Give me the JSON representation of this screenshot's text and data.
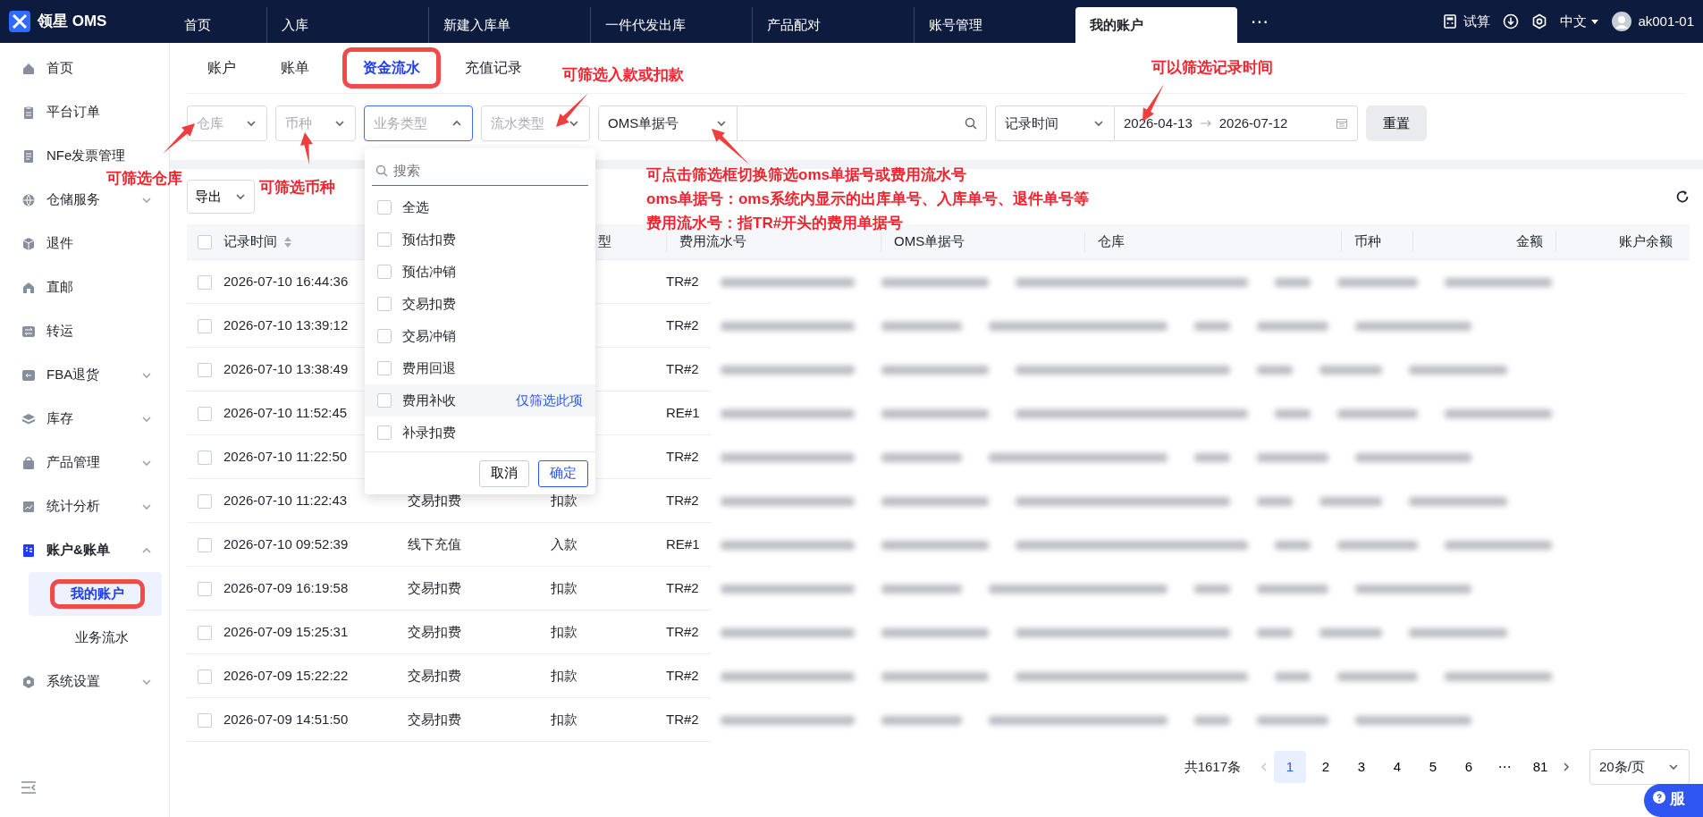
{
  "app": {
    "logo": "领星 OMS"
  },
  "top_tabs": [
    {
      "label": "首页",
      "selected": false
    },
    {
      "label": "入库",
      "selected": false
    },
    {
      "label": "新建入库单",
      "selected": false
    },
    {
      "label": "一件代发出库",
      "selected": false
    },
    {
      "label": "产品配对",
      "selected": false
    },
    {
      "label": "账号管理",
      "selected": false
    },
    {
      "label": "我的账户",
      "selected": true
    }
  ],
  "top_actions": {
    "more": "⋯",
    "trial": "试算",
    "language": "中文",
    "user": "ak001-01"
  },
  "sidebar": {
    "items": [
      {
        "label": "首页",
        "selected": false
      },
      {
        "label": "平台订单",
        "selected": false
      },
      {
        "label": "NFe发票管理",
        "selected": false
      },
      {
        "label": "仓储服务",
        "selected": false,
        "expanded": false
      },
      {
        "label": "退件",
        "selected": false
      },
      {
        "label": "直邮",
        "selected": false
      },
      {
        "label": "转运",
        "selected": false
      },
      {
        "label": "FBA退货",
        "selected": false,
        "expanded": false
      },
      {
        "label": "库存",
        "selected": false,
        "expanded": false
      },
      {
        "label": "产品管理",
        "selected": false,
        "expanded": false
      },
      {
        "label": "统计分析",
        "selected": false,
        "expanded": false
      },
      {
        "label": "账户&账单",
        "selected": true,
        "expanded": true,
        "children": [
          {
            "label": "我的账户",
            "selected": true,
            "highlighted": true
          },
          {
            "label": "业务流水",
            "selected": false,
            "highlighted": false
          }
        ]
      },
      {
        "label": "系统设置",
        "selected": false,
        "expanded": false
      }
    ]
  },
  "sub_tabs": [
    {
      "label": "账户",
      "selected": false,
      "highlighted": false
    },
    {
      "label": "账单",
      "selected": false,
      "highlighted": false
    },
    {
      "label": "资金流水",
      "selected": true,
      "highlighted": true
    },
    {
      "label": "充值记录",
      "selected": false,
      "highlighted": false
    }
  ],
  "filters": {
    "warehouse": {
      "placeholder": "仓库"
    },
    "currency": {
      "placeholder": "币种"
    },
    "business_type": {
      "placeholder": "业务类型",
      "expanded": true
    },
    "flow_type": {
      "placeholder": "流水类型"
    },
    "number_type": {
      "value": "OMS单据号"
    },
    "time_type": {
      "value": "记录时间"
    },
    "date_range": {
      "start": "2026-04-13",
      "end": "2026-07-12"
    },
    "reset": "重置"
  },
  "dropdown": {
    "search_placeholder": "搜索",
    "hover_action": "仅筛选此项",
    "cancel": "取消",
    "confirm": "确定",
    "options": [
      {
        "label": "全选",
        "checked": false,
        "hovered": false
      },
      {
        "label": "预估扣费",
        "checked": false,
        "hovered": false
      },
      {
        "label": "预估冲销",
        "checked": false,
        "hovered": false
      },
      {
        "label": "交易扣费",
        "checked": false,
        "hovered": false
      },
      {
        "label": "交易冲销",
        "checked": false,
        "hovered": false
      },
      {
        "label": "费用回退",
        "checked": false,
        "hovered": false
      },
      {
        "label": "费用补收",
        "checked": false,
        "hovered": true
      },
      {
        "label": "补录扣费",
        "checked": false,
        "hovered": false
      }
    ]
  },
  "toolbar": {
    "export": "导出"
  },
  "table": {
    "all_checked": false,
    "columns": [
      "记录时间",
      "型",
      "费用流水号",
      "OMS单据号",
      "仓库",
      "币种",
      "金额",
      "账户余额"
    ],
    "rows": [
      {
        "checked": false,
        "time": "2026-07-10 16:44:36",
        "fee_no": "TR#2"
      },
      {
        "checked": false,
        "time": "2026-07-10 13:39:12",
        "fee_no": "TR#2"
      },
      {
        "checked": false,
        "time": "2026-07-10 13:38:49",
        "fee_no": "TR#2"
      },
      {
        "checked": false,
        "time": "2026-07-10 11:52:45",
        "fee_no": "RE#1"
      },
      {
        "checked": false,
        "time": "2026-07-10 11:22:50",
        "fee_no": "TR#2"
      },
      {
        "checked": false,
        "time": "2026-07-10 11:22:43",
        "business_type": "交易扣费",
        "flow_type": "扣款",
        "fee_no": "TR#2"
      },
      {
        "checked": false,
        "time": "2026-07-10 09:52:39",
        "business_type": "线下充值",
        "flow_type": "入款",
        "fee_no": "RE#1"
      },
      {
        "checked": false,
        "time": "2026-07-09 16:19:58",
        "business_type": "交易扣费",
        "flow_type": "扣款",
        "fee_no": "TR#2"
      },
      {
        "checked": false,
        "time": "2026-07-09 15:25:31",
        "business_type": "交易扣费",
        "flow_type": "扣款",
        "fee_no": "TR#2"
      },
      {
        "checked": false,
        "time": "2026-07-09 15:22:22",
        "business_type": "交易扣费",
        "flow_type": "扣款",
        "fee_no": "TR#2"
      },
      {
        "checked": false,
        "time": "2026-07-09 14:51:50",
        "business_type": "交易扣费",
        "flow_type": "扣款",
        "fee_no": "TR#2"
      }
    ]
  },
  "pagination": {
    "total": "共1617条",
    "pages": [
      {
        "label": "1",
        "selected": true
      },
      {
        "label": "2",
        "selected": false
      },
      {
        "label": "3",
        "selected": false
      },
      {
        "label": "4",
        "selected": false
      },
      {
        "label": "5",
        "selected": false
      },
      {
        "label": "6",
        "selected": false
      },
      {
        "label": "⋯",
        "selected": false
      },
      {
        "label": "81",
        "selected": false
      }
    ],
    "page_size": "20条/页"
  },
  "service_button": "服",
  "annotations": [
    {
      "text": "可筛选入款或扣款"
    },
    {
      "text": "可以筛选记录时间"
    },
    {
      "text": "可筛选仓库"
    },
    {
      "text": "可筛选币种"
    },
    {
      "text": "可点击筛选框切换筛选oms单据号或费用流水号"
    },
    {
      "text": "oms单据号：oms系统内显示的出库单号、入库单号、退件单号等"
    },
    {
      "text": "费用流水号：指TR#开头的费用单据号"
    }
  ]
}
